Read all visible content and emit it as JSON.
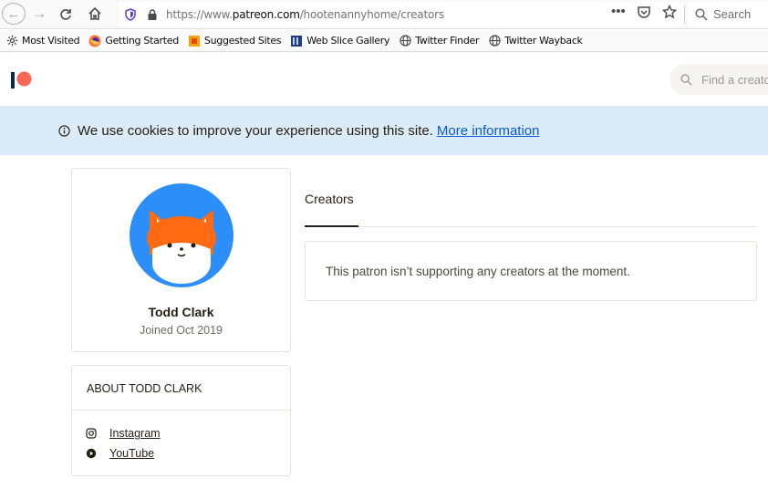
{
  "browser": {
    "url_prefix": "https://www.",
    "url_domain": "patreon.com",
    "url_path": "/hootenannyhome/creators",
    "search_placeholder": "Search",
    "bookmarks": [
      {
        "label": "Most Visited",
        "icon": "gear-icon"
      },
      {
        "label": "Getting Started",
        "icon": "firefox-icon"
      },
      {
        "label": "Suggested Sites",
        "icon": "suggested-sites-icon"
      },
      {
        "label": "Web Slice Gallery",
        "icon": "web-slice-icon"
      },
      {
        "label": "Twitter Finder",
        "icon": "globe-icon"
      },
      {
        "label": "Twitter Wayback",
        "icon": "globe-icon"
      }
    ]
  },
  "header": {
    "search_placeholder": "Find a creator",
    "brand_color": "#f96854"
  },
  "cookie_banner": {
    "text": "We use cookies to improve your experience using this site.",
    "link_label": "More information"
  },
  "profile": {
    "name": "Todd Clark",
    "joined": "Joined Oct 2019",
    "avatar_bg": "#2c8ef8"
  },
  "about": {
    "title": "ABOUT TODD CLARK",
    "links": [
      {
        "label": "Instagram",
        "icon": "instagram-icon"
      },
      {
        "label": "YouTube",
        "icon": "youtube-icon"
      }
    ]
  },
  "main": {
    "tab_label": "Creators",
    "empty_message": "This patron isn’t supporting any creators at the moment."
  }
}
